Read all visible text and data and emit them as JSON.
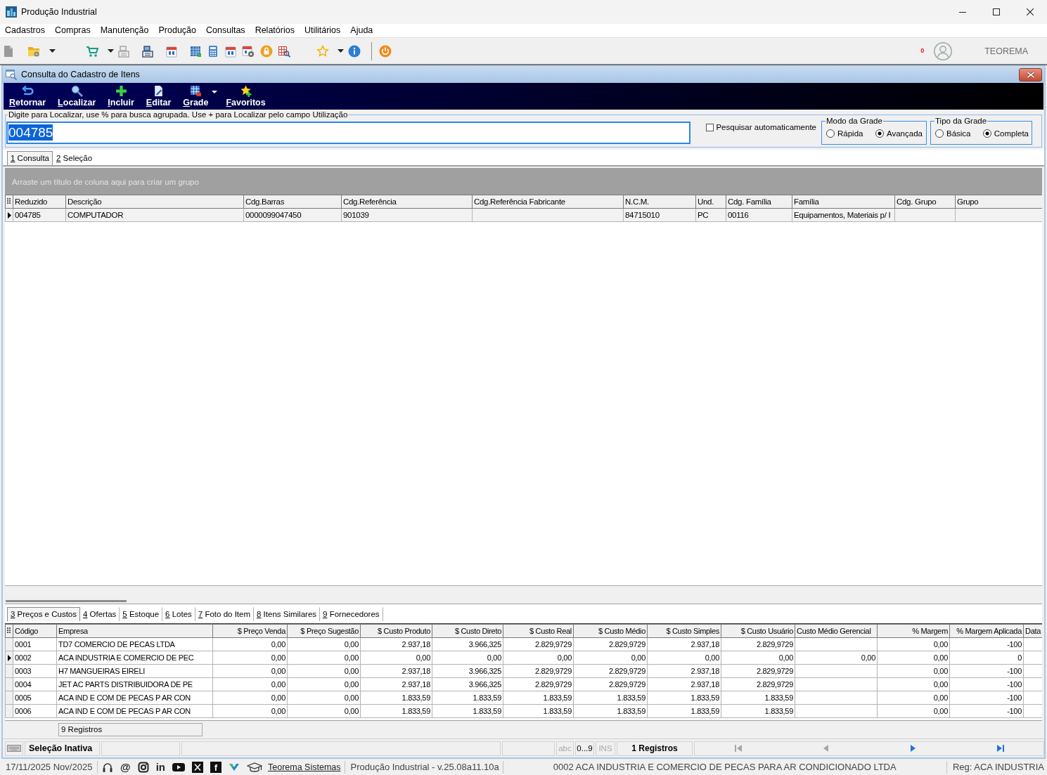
{
  "window": {
    "title": "Produção Industrial"
  },
  "menu": [
    "Cadastros",
    "Compras",
    "Manutenção",
    "Produção",
    "Consultas",
    "Relatórios",
    "Utilitários",
    "Ajuda"
  ],
  "toolbar": {
    "notification_count": "0",
    "user_name": "TEOREMA"
  },
  "child_window": {
    "title": "Consulta do Cadastro de Itens"
  },
  "actions": [
    {
      "kind": "return",
      "label": "Retornar",
      "dropdown": false
    },
    {
      "kind": "search",
      "label": "Localizar",
      "dropdown": false
    },
    {
      "kind": "add",
      "label": "Incluir",
      "dropdown": false
    },
    {
      "kind": "edit",
      "label": "Editar",
      "dropdown": false
    },
    {
      "kind": "grid",
      "label": "Grade",
      "dropdown": true
    },
    {
      "kind": "favorite",
      "label": "Favoritos",
      "dropdown": false
    }
  ],
  "search": {
    "legend": "Digite para Localizar, use % para busca agrupada. Use + para Localizar pelo campo Utilização",
    "value": "004785",
    "auto_search": {
      "label": "Pesquisar automaticamente",
      "checked": false
    }
  },
  "grid_mode": {
    "title": "Modo da Grade",
    "options": [
      {
        "label": "Rápida",
        "selected": false
      },
      {
        "label": "Avançada",
        "selected": true
      }
    ]
  },
  "grid_type": {
    "title": "Tipo da Grade",
    "options": [
      {
        "label": "Básica",
        "selected": false
      },
      {
        "label": "Completa",
        "selected": true
      }
    ]
  },
  "tabs": [
    {
      "label": "1 Consulta",
      "selected": true
    },
    {
      "label": "2 Seleção",
      "selected": false
    }
  ],
  "group_panel": {
    "hint": "Arraste um título de coluna aqui para criar um grupo"
  },
  "items_table": {
    "columns": [
      "Reduzido",
      "Descrição",
      "Cdg.Barras",
      "Cdg.Referência",
      "Cdg.Referência Fabricante",
      "N.C.M.",
      "Und.",
      "Cdg. Família",
      "Família",
      "Cdg. Grupo",
      "Grupo"
    ],
    "rows": [
      {
        "selected": true,
        "cells": [
          "004785",
          "COMPUTADOR",
          "0000099047450",
          "901039",
          null,
          "84715010",
          "PC",
          "00116",
          "Equipamentos, Materiais p/ I",
          null,
          null
        ]
      }
    ]
  },
  "detail_tabs": [
    {
      "label": "3 Preços e Custos",
      "selected": true
    },
    {
      "label": "4 Ofertas",
      "selected": false
    },
    {
      "label": "5 Estoque",
      "selected": false
    },
    {
      "label": "6 Lotes",
      "selected": false
    },
    {
      "label": "7 Foto do Item",
      "selected": false
    },
    {
      "label": "8 Itens Similares",
      "selected": false
    },
    {
      "label": "9 Fornecedores",
      "selected": false
    }
  ],
  "prices_table": {
    "columns": [
      "Código",
      "Empresa",
      "$ Preço Venda",
      "$ Preço Sugestão",
      "$ Custo Produto",
      "$ Custo Direto",
      "$ Custo Real",
      "$ Custo Médio",
      "$ Custo Simples",
      "$ Custo Usuário",
      "Custo Médio Gerencial",
      "% Margem",
      "% Margem Aplicada",
      "Data"
    ],
    "rows": [
      {
        "selected": false,
        "cells": [
          "0001",
          "TD7 COMERCIO DE PECAS LTDA",
          "0,00",
          "0,00",
          "2.937,18",
          "3.966,325",
          "2.829,9729",
          "2.829,9729",
          "2.937,18",
          "2.829,9729",
          null,
          "0,00",
          "-100",
          null
        ]
      },
      {
        "selected": true,
        "cells": [
          "0002",
          "ACA INDUSTRIA E COMERCIO DE PEC",
          "0,00",
          "0,00",
          "0,00",
          "0,00",
          "0,00",
          "0,00",
          "0,00",
          "0,00",
          "0,00",
          "0,00",
          "0",
          null
        ]
      },
      {
        "selected": false,
        "cells": [
          "0003",
          "H7 MANGUEIRAS EIRELI",
          "0,00",
          "0,00",
          "2.937,18",
          "3.966,325",
          "2.829,9729",
          "2.829,9729",
          "2.937,18",
          "2.829,9729",
          null,
          "0,00",
          "-100",
          null
        ]
      },
      {
        "selected": false,
        "cells": [
          "0004",
          "JET AC PARTS DISTRIBUIDORA DE PE",
          "0,00",
          "0,00",
          "2.937,18",
          "3.966,325",
          "2.829,9729",
          "2.829,9729",
          "2.937,18",
          "2.829,9729",
          null,
          "0,00",
          "-100",
          null
        ]
      },
      {
        "selected": false,
        "cells": [
          "0005",
          "ACA IND E COM DE PECAS P AR CON",
          "0,00",
          "0,00",
          "1.833,59",
          "1.833,59",
          "1.833,59",
          "1.833,59",
          "1.833,59",
          "1.833,59",
          null,
          "0,00",
          "-100",
          null
        ]
      },
      {
        "selected": false,
        "cells": [
          "0006",
          "ACA IND E COM DE PECAS P AR CON",
          "0,00",
          "0,00",
          "1.833,59",
          "1.833,59",
          "1.833,59",
          "1.833,59",
          "1.833,59",
          "1.833,59",
          null,
          "0,00",
          "-100",
          null
        ]
      }
    ],
    "record_count": "9 Registros"
  },
  "status_bar": {
    "selection": "Seleção Inativa",
    "indicators": [
      {
        "label": "abc",
        "enabled": false
      },
      {
        "label": "0...9",
        "enabled": true
      },
      {
        "label": "INS",
        "enabled": false
      }
    ],
    "records": "1 Registros",
    "navigation": [
      {
        "kind": "first",
        "enabled": false
      },
      {
        "kind": "previous",
        "enabled": false
      },
      {
        "kind": "next",
        "enabled": true
      },
      {
        "kind": "last",
        "enabled": true
      }
    ]
  },
  "app_status_bar": {
    "date": "17/11/2025 Nov/2025",
    "links": [
      {
        "kind": "headset"
      },
      {
        "kind": "symbol",
        "text": "@"
      },
      {
        "kind": "camera"
      },
      {
        "kind": "symbol",
        "text": "in"
      },
      {
        "kind": "play"
      },
      {
        "kind": "cross"
      },
      {
        "kind": "letter_tile",
        "text": "f"
      },
      {
        "kind": "v_mark"
      },
      {
        "kind": "cap"
      }
    ],
    "site_link": "Teorema Sistemas",
    "version": "Produção Industrial - v.25.08a11.10a",
    "company": "0002 ACA INDUSTRIA E COMERCIO DE PECAS PARA AR CONDICIONADO LTDA",
    "registration": "Reg: ACA INDUSTRIA"
  }
}
